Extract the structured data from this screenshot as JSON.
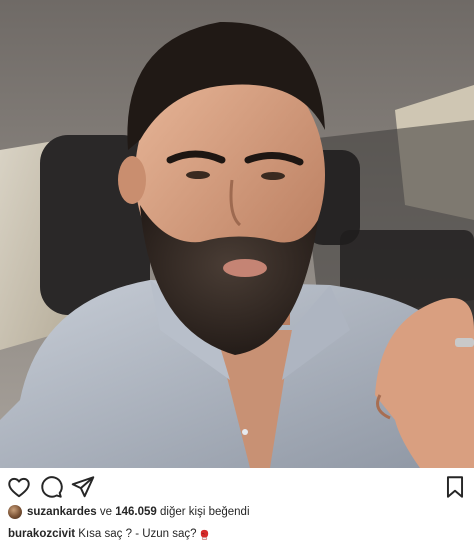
{
  "post": {
    "photo_label": "selfie",
    "likes": {
      "first_user": "suzankardes",
      "connector": " ve ",
      "count": "146.059",
      "suffix": " diğer kişi beğendi"
    },
    "caption": {
      "username": "burakozcivit",
      "text": " Kısa saç ? - Uzun saç?",
      "emoji": "boxing-glove-icon"
    }
  },
  "icons": {
    "like": "heart-icon",
    "comment": "comment-icon",
    "share": "paper-plane-icon",
    "save": "bookmark-icon"
  },
  "colors": {
    "text": "#262626",
    "background": "#ffffff",
    "glove": "#d62a2a"
  }
}
